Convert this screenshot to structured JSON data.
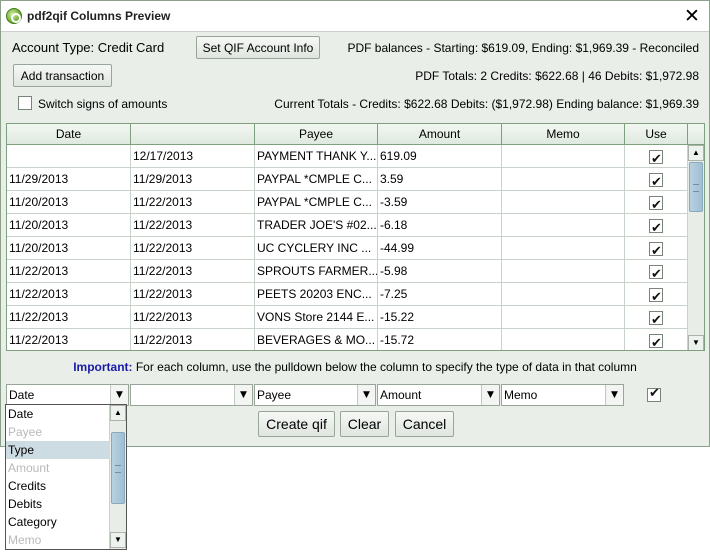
{
  "window": {
    "title": "pdf2qif Columns Preview",
    "close_glyph": "✕"
  },
  "info": {
    "account_type": "Account Type: Credit Card",
    "set_qif_button": "Set QIF Account Info",
    "pdf_balances": "PDF balances - Starting: $619.09, Ending: $1,969.39  - Reconciled",
    "add_transaction_button": "Add transaction",
    "pdf_totals": "PDF Totals:  2 Credits: $622.68 | 46 Debits: $1,972.98",
    "switch_signs_label": "Switch signs of amounts",
    "switch_signs_checked": false,
    "current_totals": "Current Totals - Credits: $622.68  Debits: ($1,972.98)   Ending balance: $1,969.39"
  },
  "table": {
    "headers": [
      "Date",
      "",
      "Payee",
      "Amount",
      "Memo",
      "Use"
    ],
    "rows": [
      {
        "date": "",
        "date2": "12/17/2013",
        "payee": "PAYMENT THANK Y...",
        "amount": "619.09",
        "memo": "",
        "use": true
      },
      {
        "date": "11/29/2013",
        "date2": "11/29/2013",
        "payee": "PAYPAL *CMPLE C...",
        "amount": "3.59",
        "memo": "",
        "use": true
      },
      {
        "date": "11/20/2013",
        "date2": "11/22/2013",
        "payee": "PAYPAL *CMPLE C...",
        "amount": "-3.59",
        "memo": "",
        "use": true
      },
      {
        "date": "11/20/2013",
        "date2": "11/22/2013",
        "payee": "TRADER JOE'S #02...",
        "amount": "-6.18",
        "memo": "",
        "use": true
      },
      {
        "date": "11/20/2013",
        "date2": "11/22/2013",
        "payee": "UC CYCLERY INC  ...",
        "amount": "-44.99",
        "memo": "",
        "use": true
      },
      {
        "date": "11/22/2013",
        "date2": "11/22/2013",
        "payee": "SPROUTS FARMER...",
        "amount": "-5.98",
        "memo": "",
        "use": true
      },
      {
        "date": "11/22/2013",
        "date2": "11/22/2013",
        "payee": "PEETS 20203  ENC...",
        "amount": "-7.25",
        "memo": "",
        "use": true
      },
      {
        "date": "11/22/2013",
        "date2": "11/22/2013",
        "payee": "VONS  Store 2144 E...",
        "amount": "-15.22",
        "memo": "",
        "use": true
      },
      {
        "date": "11/22/2013",
        "date2": "11/22/2013",
        "payee": "BEVERAGES & MO...",
        "amount": "-15.72",
        "memo": "",
        "use": true
      }
    ]
  },
  "important": {
    "label": "Important:",
    "text": " For each column, use the pulldown below the column to specify the type of data in that column"
  },
  "column_types": {
    "values": [
      "Date",
      "",
      "Payee",
      "Amount",
      "Memo"
    ],
    "use_checked": true
  },
  "buttons": {
    "create": "Create qif",
    "clear": "Clear",
    "cancel": "Cancel"
  },
  "dropdown": {
    "options": [
      {
        "label": "Date",
        "state": "normal"
      },
      {
        "label": "Payee",
        "state": "disabled"
      },
      {
        "label": "Type",
        "state": "selected"
      },
      {
        "label": "Amount",
        "state": "disabled"
      },
      {
        "label": "Credits",
        "state": "normal"
      },
      {
        "label": "Debits",
        "state": "normal"
      },
      {
        "label": "Category",
        "state": "normal"
      },
      {
        "label": "Memo",
        "state": "disabled"
      }
    ]
  }
}
